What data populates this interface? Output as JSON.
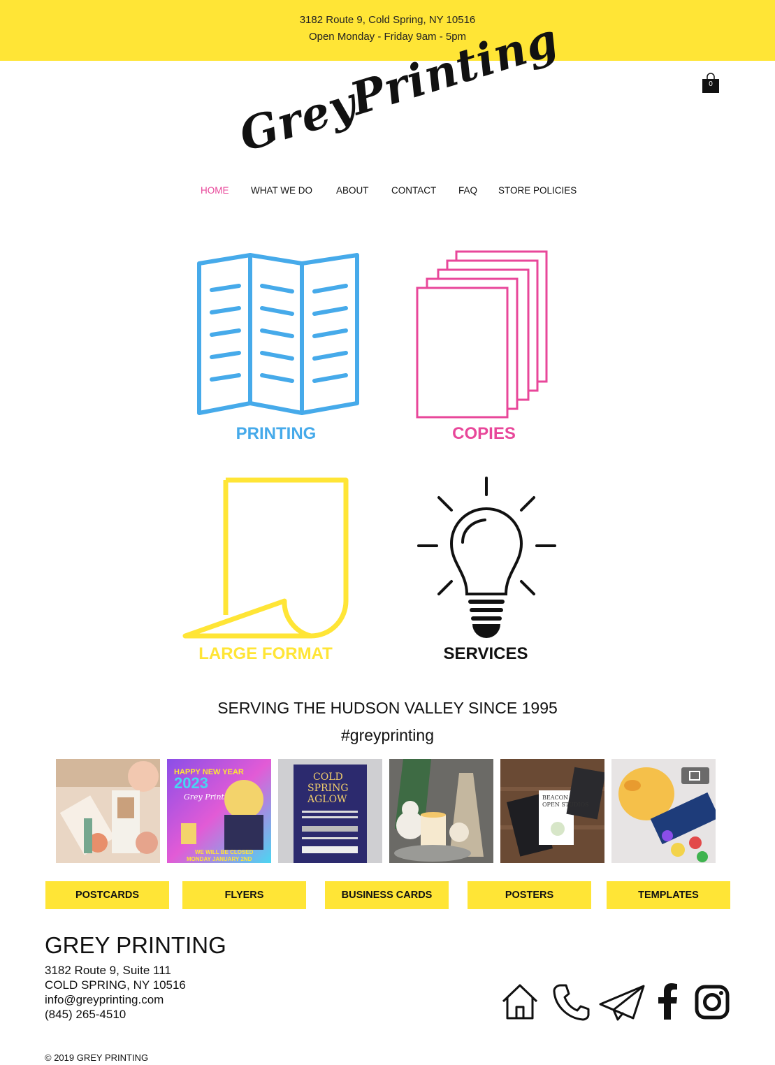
{
  "topbar": {
    "address": "3182 Route 9, Cold Spring, NY 10516",
    "hours": "Open Monday - Friday 9am - 5pm",
    "background": "#ffe536"
  },
  "cart": {
    "count": "0",
    "icon": "shopping-bag-icon"
  },
  "logo": {
    "word1": "Grey",
    "word2": "Printing"
  },
  "nav": {
    "items": [
      "HOME",
      "WHAT WE DO",
      "ABOUT",
      "CONTACT",
      "FAQ",
      "STORE POLICIES"
    ],
    "active": "HOME",
    "active_color": "#e8479a"
  },
  "tiles": [
    {
      "label": "PRINTING",
      "icon": "folded-brochure-icon",
      "color": "#46aaea"
    },
    {
      "label": "COPIES",
      "icon": "stacked-pages-icon",
      "color": "#e8479a"
    },
    {
      "label": "LARGE FORMAT",
      "icon": "curled-sheet-icon",
      "color": "#ffe536"
    },
    {
      "label": "SERVICES",
      "icon": "lightbulb-icon",
      "color": "#111111"
    }
  ],
  "tagline": {
    "line1": "SERVING THE HUDSON VALLEY SINCE 1995",
    "line2": "#greyprinting"
  },
  "gallery": {
    "photos": [
      {
        "name": "photo-bookmarks",
        "text": ""
      },
      {
        "name": "photo-new-year-flyer",
        "text": "HAPPY NEW YEAR 2023 · Grey Printing · WE WILL BE CLOSED MONDAY JANUARY 2ND"
      },
      {
        "name": "photo-cold-spring-aglow",
        "text": "COLD SPRING AGLOW"
      },
      {
        "name": "photo-holiday-display",
        "text": ""
      },
      {
        "name": "photo-beacon-open-studios",
        "text": "BEACON OPEN STUDIOS"
      },
      {
        "name": "photo-rubber-duck",
        "text": ""
      }
    ]
  },
  "categories": [
    "POSTCARDS",
    "FLYERS",
    "BUSINESS CARDS",
    "POSTERS",
    "TEMPLATES"
  ],
  "footer": {
    "company": "GREY PRINTING",
    "address1": "3182 Route 9, Suite 111",
    "address2": "COLD SPRING, NY  10516",
    "email": "info@greyprinting.com",
    "phone": "(845) 265-4510",
    "copyright": "© 2019 GREY PRINTING",
    "social": [
      "home-icon",
      "phone-icon",
      "paper-plane-icon",
      "facebook-icon",
      "instagram-icon"
    ]
  }
}
